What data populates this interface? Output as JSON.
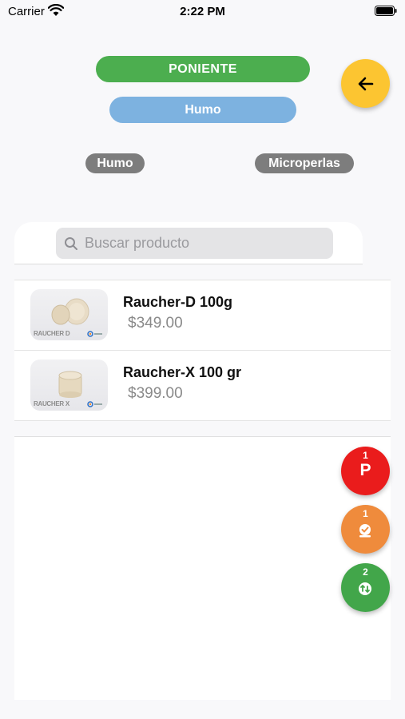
{
  "status_bar": {
    "carrier": "Carrier",
    "time": "2:22 PM"
  },
  "header": {
    "region": "PONIENTE",
    "category": "Humo"
  },
  "filters": {
    "chips": [
      "Humo",
      "Microperlas"
    ]
  },
  "search": {
    "placeholder": "Buscar producto",
    "value": ""
  },
  "products": [
    {
      "name": "Raucher-D 100g",
      "price": "$349.00",
      "thumb_caption": "RAUCHER D"
    },
    {
      "name": "Raucher-X 100 gr",
      "price": "$399.00",
      "thumb_caption": "RAUCHER X"
    }
  ],
  "floating_actions": [
    {
      "count": "1",
      "label": "P",
      "color": "#ea1c1c",
      "icon": "p-letter"
    },
    {
      "count": "1",
      "label": "",
      "color": "#ef8b3c",
      "icon": "check-badge-icon"
    },
    {
      "count": "2",
      "label": "",
      "color": "#42a64a",
      "icon": "sync-icon"
    }
  ],
  "colors": {
    "region_pill": "#4cae4f",
    "category_pill": "#7db2e0",
    "back_button": "#fcc531",
    "chip": "#7d7d7d"
  }
}
